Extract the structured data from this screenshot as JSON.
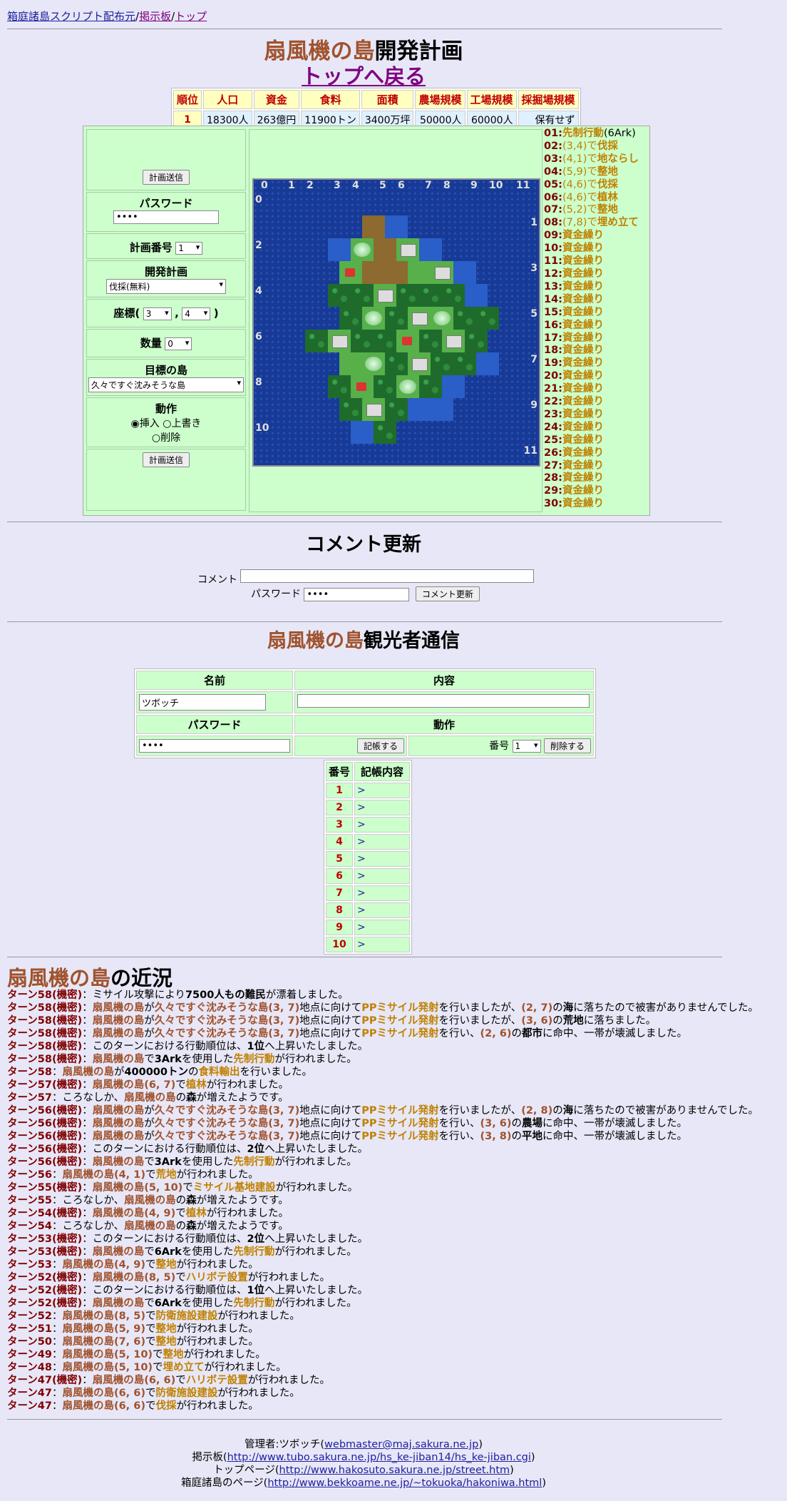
{
  "nav": {
    "home": "箱庭諸島スクリプト配布元",
    "sep": "/",
    "bbs": "掲示板",
    "top": "トップ"
  },
  "header": {
    "island": "扇風機の島",
    "title_suffix": "開発計画",
    "back": "トップへ戻る"
  },
  "stats": {
    "headers": [
      "順位",
      "人口",
      "資金",
      "食料",
      "面積",
      "農場規模",
      "工場規模",
      "採掘場規模"
    ],
    "row": [
      "1",
      "18300人",
      "263億円",
      "11900トン",
      "3400万坪",
      "50000人",
      "60000人",
      "保有せず"
    ]
  },
  "form": {
    "submit": "計画送信",
    "password_label": "パスワード",
    "password_value": "••••",
    "plan_no_label": "計画番号",
    "plan_no_value": "1",
    "plan_label": "開発計画",
    "plan_value": "伐採(無料)",
    "coord_label": "座標(",
    "coord_x": "3",
    "coord_comma": ",",
    "coord_y": "4",
    "coord_close": ")",
    "qty_label": "数量",
    "qty_value": "0",
    "target_label": "目標の島",
    "target_value": "久々ですぐ沈みそうな島",
    "action_label": "動作",
    "action_insert": "挿入",
    "action_overwrite": "上書き",
    "action_delete": "削除"
  },
  "map": {
    "cols": [
      "0",
      "1",
      "2",
      "3",
      "4",
      "5",
      "6",
      "7",
      "8",
      "9",
      "10",
      "11"
    ],
    "rows_left": [
      "0",
      "2",
      "4",
      "6",
      "8",
      "10"
    ],
    "rows_right": [
      "1",
      "3",
      "5",
      "7",
      "9",
      "11"
    ]
  },
  "commands": [
    {
      "n": "01:",
      "pre": "",
      "cmd": "先制行動",
      "post": "(6Ark)"
    },
    {
      "n": "02:",
      "pre": "(3,4)で",
      "cmd": "伐採",
      "post": ""
    },
    {
      "n": "03:",
      "pre": "(4,1)で",
      "cmd": "地ならし",
      "post": ""
    },
    {
      "n": "04:",
      "pre": "(5,9)で",
      "cmd": "整地",
      "post": ""
    },
    {
      "n": "05:",
      "pre": "(4,6)で",
      "cmd": "伐採",
      "post": ""
    },
    {
      "n": "06:",
      "pre": "(4,6)で",
      "cmd": "植林",
      "post": ""
    },
    {
      "n": "07:",
      "pre": "(5,2)で",
      "cmd": "整地",
      "post": ""
    },
    {
      "n": "08:",
      "pre": "(7,8)で",
      "cmd": "埋め立て",
      "post": ""
    },
    {
      "n": "09:",
      "pre": "",
      "cmd": "資金繰り",
      "post": ""
    },
    {
      "n": "10:",
      "pre": "",
      "cmd": "資金繰り",
      "post": ""
    },
    {
      "n": "11:",
      "pre": "",
      "cmd": "資金繰り",
      "post": ""
    },
    {
      "n": "12:",
      "pre": "",
      "cmd": "資金繰り",
      "post": ""
    },
    {
      "n": "13:",
      "pre": "",
      "cmd": "資金繰り",
      "post": ""
    },
    {
      "n": "14:",
      "pre": "",
      "cmd": "資金繰り",
      "post": ""
    },
    {
      "n": "15:",
      "pre": "",
      "cmd": "資金繰り",
      "post": ""
    },
    {
      "n": "16:",
      "pre": "",
      "cmd": "資金繰り",
      "post": ""
    },
    {
      "n": "17:",
      "pre": "",
      "cmd": "資金繰り",
      "post": ""
    },
    {
      "n": "18:",
      "pre": "",
      "cmd": "資金繰り",
      "post": ""
    },
    {
      "n": "19:",
      "pre": "",
      "cmd": "資金繰り",
      "post": ""
    },
    {
      "n": "20:",
      "pre": "",
      "cmd": "資金繰り",
      "post": ""
    },
    {
      "n": "21:",
      "pre": "",
      "cmd": "資金繰り",
      "post": ""
    },
    {
      "n": "22:",
      "pre": "",
      "cmd": "資金繰り",
      "post": ""
    },
    {
      "n": "23:",
      "pre": "",
      "cmd": "資金繰り",
      "post": ""
    },
    {
      "n": "24:",
      "pre": "",
      "cmd": "資金繰り",
      "post": ""
    },
    {
      "n": "25:",
      "pre": "",
      "cmd": "資金繰り",
      "post": ""
    },
    {
      "n": "26:",
      "pre": "",
      "cmd": "資金繰り",
      "post": ""
    },
    {
      "n": "27:",
      "pre": "",
      "cmd": "資金繰り",
      "post": ""
    },
    {
      "n": "28:",
      "pre": "",
      "cmd": "資金繰り",
      "post": ""
    },
    {
      "n": "29:",
      "pre": "",
      "cmd": "資金繰り",
      "post": ""
    },
    {
      "n": "30:",
      "pre": "",
      "cmd": "資金繰り",
      "post": ""
    }
  ],
  "comment": {
    "title": "コメント更新",
    "label": "コメント",
    "pw_label": "パスワード",
    "pw_value": "••••",
    "button": "コメント更新"
  },
  "tourist": {
    "title_suffix": "観光者通信",
    "name_h": "名前",
    "content_h": "内容",
    "pw_h": "パスワード",
    "action_h": "動作",
    "name_value": "ツボッチ",
    "pw_value": "••••",
    "post_btn": "記帳する",
    "num_label": "番号",
    "num_value": "1",
    "del_btn": "削除する"
  },
  "board": {
    "h_no": "番号",
    "h_content": "記帳内容",
    "rows": [
      "1",
      "2",
      "3",
      "4",
      "5",
      "6",
      "7",
      "8",
      "9",
      "10"
    ],
    "arrow": ">"
  },
  "recent_suffix": "の近況",
  "logs": [
    [
      [
        "t",
        "ターン58(機密)"
      ],
      [
        "",
        "：ミサイル攻撃により"
      ],
      [
        "b",
        "7500人もの難民"
      ],
      [
        "",
        "が漂着しました。"
      ]
    ],
    [
      [
        "t",
        "ターン58(機密)"
      ],
      [
        "",
        "："
      ],
      [
        "i",
        "扇風機の島"
      ],
      [
        "",
        "が"
      ],
      [
        "i",
        "久々ですぐ沈みそうな島(3, 7)"
      ],
      [
        "",
        "地点に向けて"
      ],
      [
        "h",
        "PPミサイル発射"
      ],
      [
        "",
        "を行いましたが、"
      ],
      [
        "i",
        "(2, 7)"
      ],
      [
        "",
        "の"
      ],
      [
        "b",
        "海"
      ],
      [
        "",
        "に落ちたので被害がありませんでした。"
      ]
    ],
    [
      [
        "t",
        "ターン58(機密)"
      ],
      [
        "",
        "："
      ],
      [
        "i",
        "扇風機の島"
      ],
      [
        "",
        "が"
      ],
      [
        "i",
        "久々ですぐ沈みそうな島(3, 7)"
      ],
      [
        "",
        "地点に向けて"
      ],
      [
        "h",
        "PPミサイル発射"
      ],
      [
        "",
        "を行いましたが、"
      ],
      [
        "i",
        "(3, 6)"
      ],
      [
        "",
        "の"
      ],
      [
        "b",
        "荒地"
      ],
      [
        "",
        "に落ちました。"
      ]
    ],
    [
      [
        "t",
        "ターン58(機密)"
      ],
      [
        "",
        "："
      ],
      [
        "i",
        "扇風機の島"
      ],
      [
        "",
        "が"
      ],
      [
        "i",
        "久々ですぐ沈みそうな島(3, 7)"
      ],
      [
        "",
        "地点に向けて"
      ],
      [
        "h",
        "PPミサイル発射"
      ],
      [
        "",
        "を行い、"
      ],
      [
        "i",
        "(2, 6)"
      ],
      [
        "",
        "の"
      ],
      [
        "b",
        "都市"
      ],
      [
        "",
        "に命中、一帯が壊滅しました。"
      ]
    ],
    [
      [
        "t",
        "ターン58(機密)"
      ],
      [
        "",
        "：このターンにおける行動順位は、"
      ],
      [
        "b",
        "1位"
      ],
      [
        "",
        "へ上昇いたしました。"
      ]
    ],
    [
      [
        "t",
        "ターン58(機密)"
      ],
      [
        "",
        "："
      ],
      [
        "i",
        "扇風機の島"
      ],
      [
        "",
        "で"
      ],
      [
        "b",
        "3Ark"
      ],
      [
        "",
        "を使用した"
      ],
      [
        "h",
        "先制行動"
      ],
      [
        "",
        "が行われました。"
      ]
    ],
    [
      [
        "t",
        "ターン58"
      ],
      [
        "",
        "："
      ],
      [
        "i",
        "扇風機の島"
      ],
      [
        "",
        "が"
      ],
      [
        "b",
        "400000トン"
      ],
      [
        "",
        "の"
      ],
      [
        "h",
        "食料輸出"
      ],
      [
        "",
        "を行いました。"
      ]
    ],
    [
      [
        "t",
        "ターン57(機密)"
      ],
      [
        "",
        "："
      ],
      [
        "i",
        "扇風機の島(6, 7)"
      ],
      [
        "",
        "で"
      ],
      [
        "h",
        "植林"
      ],
      [
        "",
        "が行われました。"
      ]
    ],
    [
      [
        "t",
        "ターン57"
      ],
      [
        "",
        "：ころなしか、"
      ],
      [
        "i",
        "扇風機の島"
      ],
      [
        "",
        "の"
      ],
      [
        "b",
        "森"
      ],
      [
        "",
        "が増えたようです。"
      ]
    ],
    [
      [
        "t",
        "ターン56(機密)"
      ],
      [
        "",
        "："
      ],
      [
        "i",
        "扇風機の島"
      ],
      [
        "",
        "が"
      ],
      [
        "i",
        "久々ですぐ沈みそうな島(3, 7)"
      ],
      [
        "",
        "地点に向けて"
      ],
      [
        "h",
        "PPミサイル発射"
      ],
      [
        "",
        "を行いましたが、"
      ],
      [
        "i",
        "(2, 8)"
      ],
      [
        "",
        "の"
      ],
      [
        "b",
        "海"
      ],
      [
        "",
        "に落ちたので被害がありませんでした。"
      ]
    ],
    [
      [
        "t",
        "ターン56(機密)"
      ],
      [
        "",
        "："
      ],
      [
        "i",
        "扇風機の島"
      ],
      [
        "",
        "が"
      ],
      [
        "i",
        "久々ですぐ沈みそうな島(3, 7)"
      ],
      [
        "",
        "地点に向けて"
      ],
      [
        "h",
        "PPミサイル発射"
      ],
      [
        "",
        "を行い、"
      ],
      [
        "i",
        "(3, 6)"
      ],
      [
        "",
        "の"
      ],
      [
        "b",
        "農場"
      ],
      [
        "",
        "に命中、一帯が壊滅しました。"
      ]
    ],
    [
      [
        "t",
        "ターン56(機密)"
      ],
      [
        "",
        "："
      ],
      [
        "i",
        "扇風機の島"
      ],
      [
        "",
        "が"
      ],
      [
        "i",
        "久々ですぐ沈みそうな島(3, 7)"
      ],
      [
        "",
        "地点に向けて"
      ],
      [
        "h",
        "PPミサイル発射"
      ],
      [
        "",
        "を行い、"
      ],
      [
        "i",
        "(3, 8)"
      ],
      [
        "",
        "の"
      ],
      [
        "b",
        "平地"
      ],
      [
        "",
        "に命中、一帯が壊滅しました。"
      ]
    ],
    [
      [
        "t",
        "ターン56(機密)"
      ],
      [
        "",
        "：このターンにおける行動順位は、"
      ],
      [
        "b",
        "2位"
      ],
      [
        "",
        "へ上昇いたしました。"
      ]
    ],
    [
      [
        "t",
        "ターン56(機密)"
      ],
      [
        "",
        "："
      ],
      [
        "i",
        "扇風機の島"
      ],
      [
        "",
        "で"
      ],
      [
        "b",
        "3Ark"
      ],
      [
        "",
        "を使用した"
      ],
      [
        "h",
        "先制行動"
      ],
      [
        "",
        "が行われました。"
      ]
    ],
    [
      [
        "t",
        "ターン56"
      ],
      [
        "",
        "："
      ],
      [
        "i",
        "扇風機の島(4, 1)"
      ],
      [
        "",
        "で"
      ],
      [
        "h",
        "荒地"
      ],
      [
        "",
        "が行われました。"
      ]
    ],
    [
      [
        "t",
        "ターン55(機密)"
      ],
      [
        "",
        "："
      ],
      [
        "i",
        "扇風機の島(5, 10)"
      ],
      [
        "",
        "で"
      ],
      [
        "h",
        "ミサイル基地建設"
      ],
      [
        "",
        "が行われました。"
      ]
    ],
    [
      [
        "t",
        "ターン55"
      ],
      [
        "",
        "：ころなしか、"
      ],
      [
        "i",
        "扇風機の島"
      ],
      [
        "",
        "の"
      ],
      [
        "b",
        "森"
      ],
      [
        "",
        "が増えたようです。"
      ]
    ],
    [
      [
        "t",
        "ターン54(機密)"
      ],
      [
        "",
        "："
      ],
      [
        "i",
        "扇風機の島(4, 9)"
      ],
      [
        "",
        "で"
      ],
      [
        "h",
        "植林"
      ],
      [
        "",
        "が行われました。"
      ]
    ],
    [
      [
        "t",
        "ターン54"
      ],
      [
        "",
        "：ころなしか、"
      ],
      [
        "i",
        "扇風機の島"
      ],
      [
        "",
        "の"
      ],
      [
        "b",
        "森"
      ],
      [
        "",
        "が増えたようです。"
      ]
    ],
    [
      [
        "t",
        "ターン53(機密)"
      ],
      [
        "",
        "：このターンにおける行動順位は、"
      ],
      [
        "b",
        "2位"
      ],
      [
        "",
        "へ上昇いたしました。"
      ]
    ],
    [
      [
        "t",
        "ターン53(機密)"
      ],
      [
        "",
        "："
      ],
      [
        "i",
        "扇風機の島"
      ],
      [
        "",
        "で"
      ],
      [
        "b",
        "6Ark"
      ],
      [
        "",
        "を使用した"
      ],
      [
        "h",
        "先制行動"
      ],
      [
        "",
        "が行われました。"
      ]
    ],
    [
      [
        "t",
        "ターン53"
      ],
      [
        "",
        "："
      ],
      [
        "i",
        "扇風機の島(4, 9)"
      ],
      [
        "",
        "で"
      ],
      [
        "h",
        "整地"
      ],
      [
        "",
        "が行われました。"
      ]
    ],
    [
      [
        "t",
        "ターン52(機密)"
      ],
      [
        "",
        "："
      ],
      [
        "i",
        "扇風機の島(8, 5)"
      ],
      [
        "",
        "で"
      ],
      [
        "h",
        "ハリボテ設置"
      ],
      [
        "",
        "が行われました。"
      ]
    ],
    [
      [
        "t",
        "ターン52(機密)"
      ],
      [
        "",
        "：このターンにおける行動順位は、"
      ],
      [
        "b",
        "1位"
      ],
      [
        "",
        "へ上昇いたしました。"
      ]
    ],
    [
      [
        "t",
        "ターン52(機密)"
      ],
      [
        "",
        "："
      ],
      [
        "i",
        "扇風機の島"
      ],
      [
        "",
        "で"
      ],
      [
        "b",
        "6Ark"
      ],
      [
        "",
        "を使用した"
      ],
      [
        "h",
        "先制行動"
      ],
      [
        "",
        "が行われました。"
      ]
    ],
    [
      [
        "t",
        "ターン52"
      ],
      [
        "",
        "："
      ],
      [
        "i",
        "扇風機の島(8, 5)"
      ],
      [
        "",
        "で"
      ],
      [
        "h",
        "防衛施設建設"
      ],
      [
        "",
        "が行われました。"
      ]
    ],
    [
      [
        "t",
        "ターン51"
      ],
      [
        "",
        "："
      ],
      [
        "i",
        "扇風機の島(5, 9)"
      ],
      [
        "",
        "で"
      ],
      [
        "h",
        "整地"
      ],
      [
        "",
        "が行われました。"
      ]
    ],
    [
      [
        "t",
        "ターン50"
      ],
      [
        "",
        "："
      ],
      [
        "i",
        "扇風機の島(7, 6)"
      ],
      [
        "",
        "で"
      ],
      [
        "h",
        "整地"
      ],
      [
        "",
        "が行われました。"
      ]
    ],
    [
      [
        "t",
        "ターン49"
      ],
      [
        "",
        "："
      ],
      [
        "i",
        "扇風機の島(5, 10)"
      ],
      [
        "",
        "で"
      ],
      [
        "h",
        "整地"
      ],
      [
        "",
        "が行われました。"
      ]
    ],
    [
      [
        "t",
        "ターン48"
      ],
      [
        "",
        "："
      ],
      [
        "i",
        "扇風機の島(5, 10)"
      ],
      [
        "",
        "で"
      ],
      [
        "h",
        "埋め立て"
      ],
      [
        "",
        "が行われました。"
      ]
    ],
    [
      [
        "t",
        "ターン47(機密)"
      ],
      [
        "",
        "："
      ],
      [
        "i",
        "扇風機の島(6, 6)"
      ],
      [
        "",
        "で"
      ],
      [
        "h",
        "ハリボテ設置"
      ],
      [
        "",
        "が行われました。"
      ]
    ],
    [
      [
        "t",
        "ターン47"
      ],
      [
        "",
        "："
      ],
      [
        "i",
        "扇風機の島(6, 6)"
      ],
      [
        "",
        "で"
      ],
      [
        "h",
        "防衛施設建設"
      ],
      [
        "",
        "が行われました。"
      ]
    ],
    [
      [
        "t",
        "ターン47"
      ],
      [
        "",
        "："
      ],
      [
        "i",
        "扇風機の島(6, 6)"
      ],
      [
        "",
        "で"
      ],
      [
        "h",
        "伐採"
      ],
      [
        "",
        "が行われました。"
      ]
    ]
  ],
  "footer": {
    "admin_pre": "管理者:ツボッチ(",
    "admin_mail": "webmaster@maj.sakura.ne.jp",
    "close": ")",
    "bbs_pre": "掲示板(",
    "bbs_url": "http://www.tubo.sakura.ne.jp/hs_ke-jiban14/hs_ke-jiban.cgi",
    "top_pre": "トップページ(",
    "top_url": "http://www.hakosuto.sakura.ne.jp/street.htm",
    "home_pre": "箱庭諸島のページ(",
    "home_url": "http://www.bekkoame.ne.jp/~tokuoka/hakoniwa.html"
  }
}
